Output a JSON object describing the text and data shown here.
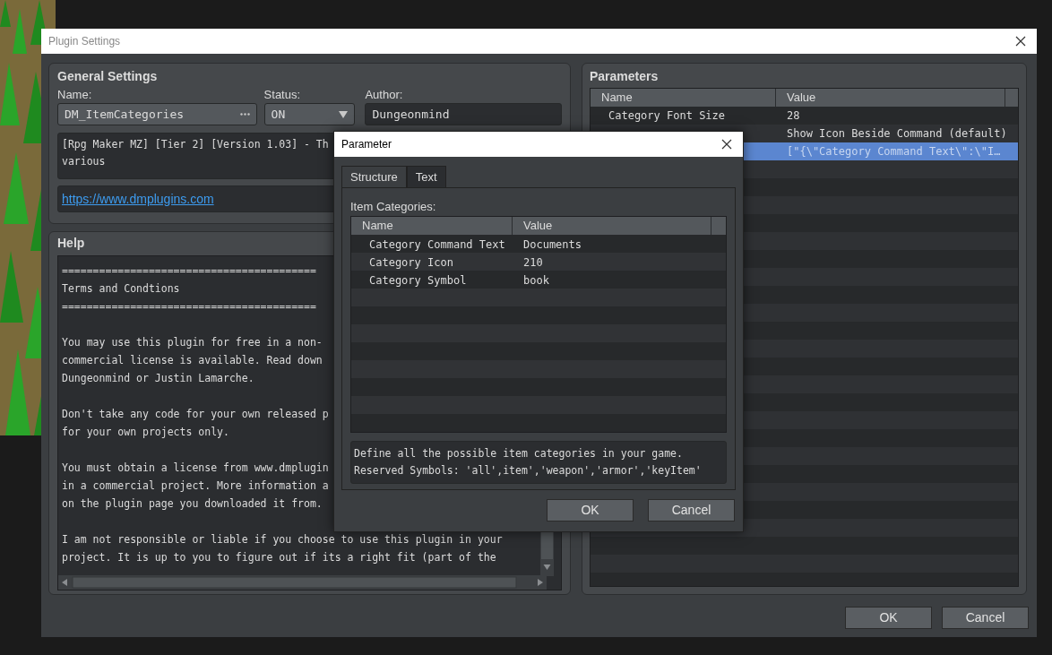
{
  "window": {
    "title": "Plugin Settings"
  },
  "general_settings": {
    "title": "General Settings",
    "name": {
      "label": "Name:",
      "value": "DM_ItemCategories"
    },
    "status": {
      "label": "Status:",
      "value": "ON"
    },
    "author": {
      "label": "Author:",
      "value": "Dungeonmind"
    },
    "description": [
      "[Rpg Maker MZ] [Tier 2] [Version 1.03] - Th",
      "various"
    ],
    "url": "https://www.dmplugins.com"
  },
  "help": {
    "title": "Help",
    "paragraphs": [
      [
        "=========================================",
        "Terms and Condtions",
        "========================================="
      ],
      [
        "You may use this plugin for free in a non-",
        "commercial license is available. Read down",
        "Dungeonmind or Justin Lamarche."
      ],
      [
        "Don't take any code for your own released p",
        "for your own projects only."
      ],
      [
        "You must obtain a license from www.dmplugin",
        "in a commercial project. More information a",
        "on the plugin page you downloaded it from."
      ],
      [
        "I am not responsible or liable if you choose to use this plugin in your",
        "project. It is up to you to figure out if its a right fit (part of the"
      ]
    ]
  },
  "parameters": {
    "title": "Parameters",
    "columns": [
      "Name",
      "Value"
    ],
    "rows": [
      {
        "name": "Category Font Size",
        "value": "28",
        "selected": false
      },
      {
        "value": "Show Icon Beside Command (default)",
        "selected": false
      },
      {
        "value": "[\"{\\\"Category Command Text\\\":\\\"I…",
        "selected": true
      }
    ]
  },
  "buttons": [
    "OK",
    "Cancel"
  ],
  "parameter_dialog": {
    "title": "Parameter",
    "tabs": [
      {
        "label": "Structure",
        "selected": true
      },
      {
        "label": "Text",
        "selected": false
      }
    ],
    "list_label": "Item Categories:",
    "columns": [
      "Name",
      "Value"
    ],
    "rows": [
      {
        "name": "Category Command Text",
        "value": "Documents"
      },
      {
        "name": "Category Icon",
        "value": "210"
      },
      {
        "name": "Category Symbol",
        "value": "book"
      }
    ],
    "description": [
      "Define all the possible item categories in your game.",
      "Reserved Symbols: 'all',item','weapon','armor','keyItem'"
    ],
    "buttons": [
      "OK",
      "Cancel"
    ]
  }
}
